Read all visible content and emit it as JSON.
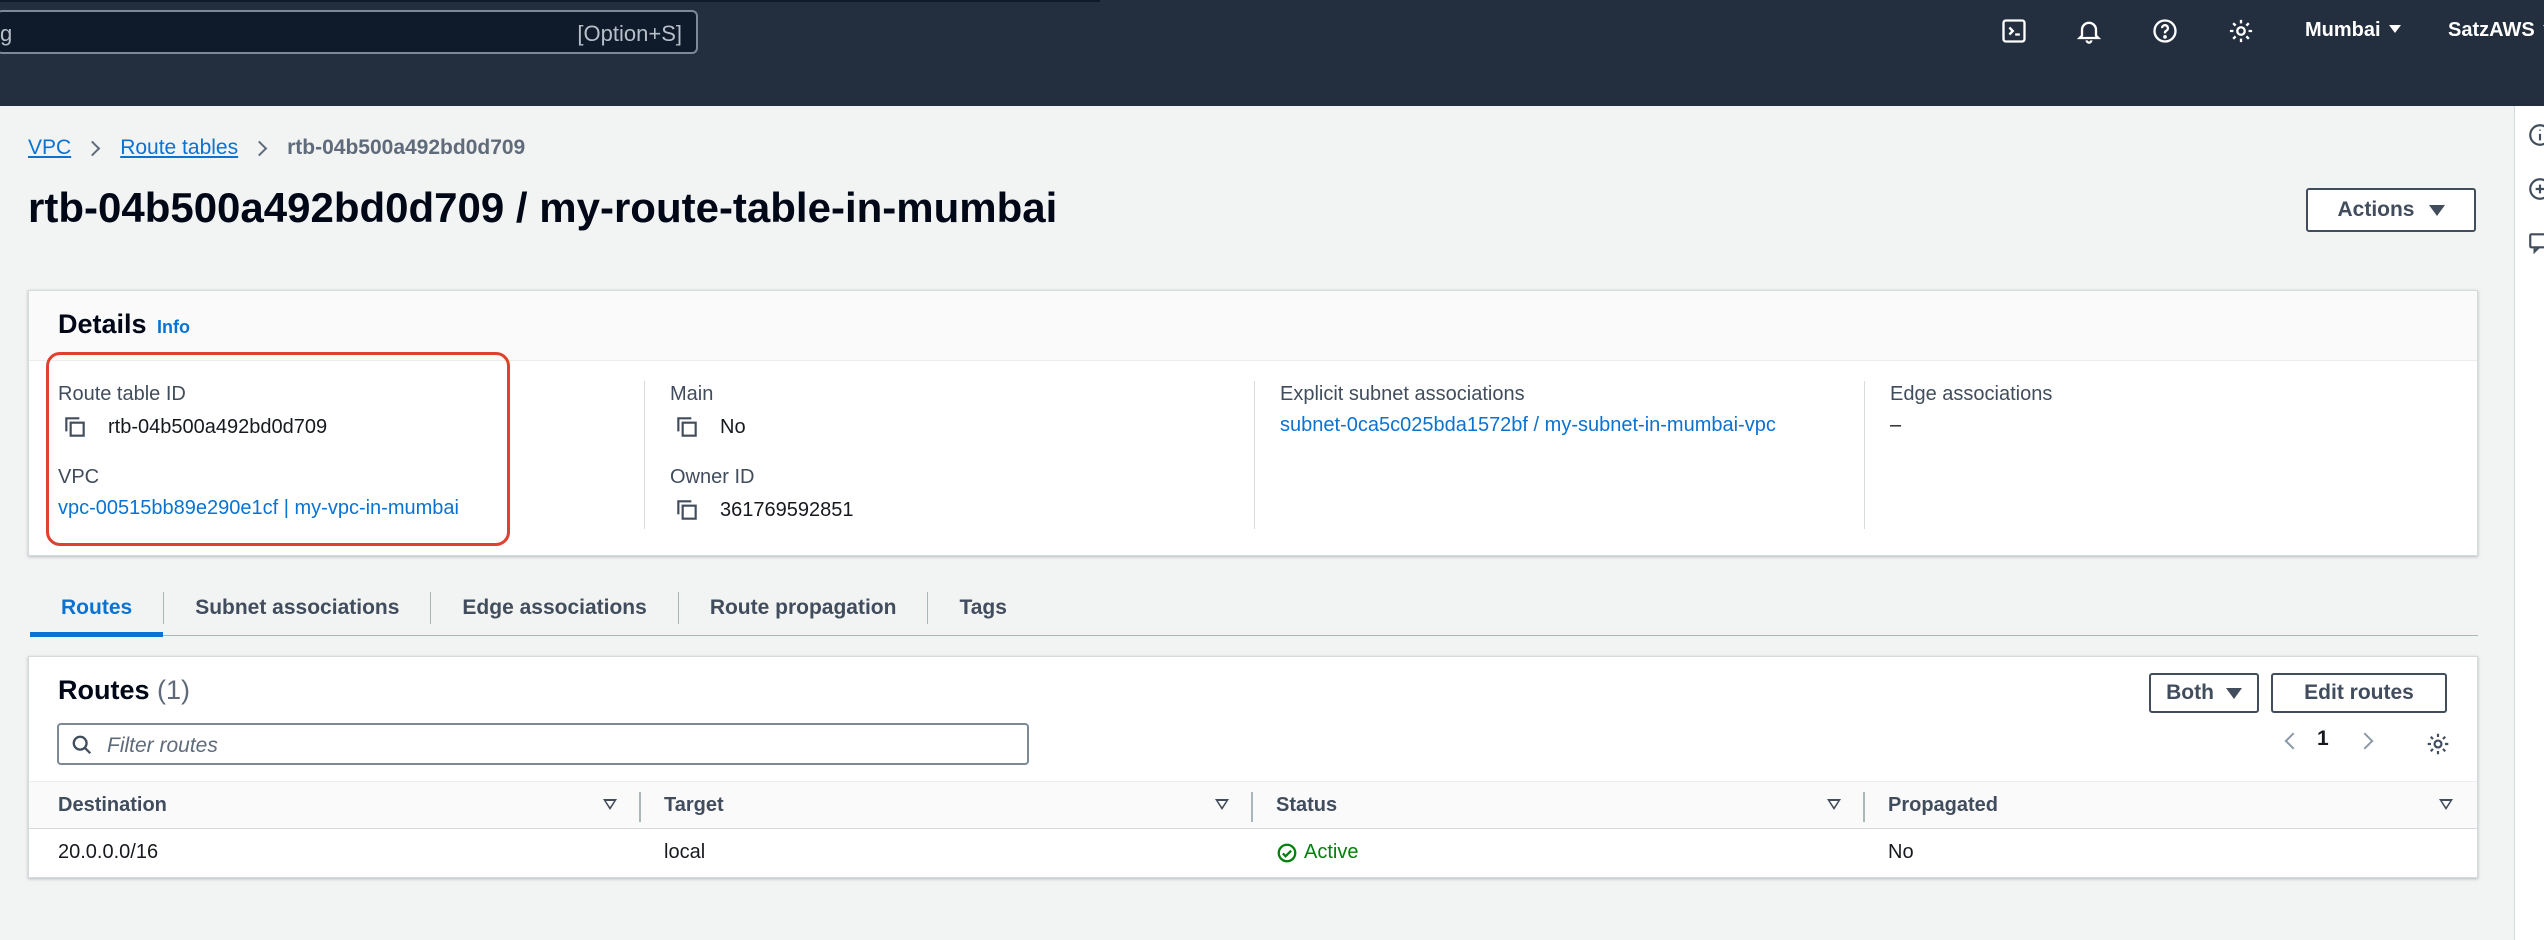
{
  "topbar": {
    "search_placeholder": "g",
    "search_shortcut": "[Option+S]",
    "region": "Mumbai",
    "account": "SatzAWS"
  },
  "breadcrumb": {
    "items": [
      "VPC",
      "Route tables"
    ],
    "current": "rtb-04b500a492bd0d709"
  },
  "page": {
    "title": "rtb-04b500a492bd0d709 / my-route-table-in-mumbai",
    "actions_label": "Actions"
  },
  "details": {
    "title": "Details",
    "info": "Info",
    "route_table_id_label": "Route table ID",
    "route_table_id": "rtb-04b500a492bd0d709",
    "vpc_label": "VPC",
    "vpc": "vpc-00515bb89e290e1cf | my-vpc-in-mumbai",
    "main_label": "Main",
    "main": "No",
    "owner_label": "Owner ID",
    "owner": "361769592851",
    "explicit_label": "Explicit subnet associations",
    "explicit": "subnet-0ca5c025bda1572bf / my-subnet-in-mumbai-vpc",
    "edge_label": "Edge associations",
    "edge": "–"
  },
  "tabs": [
    "Routes",
    "Subnet associations",
    "Edge associations",
    "Route propagation",
    "Tags"
  ],
  "routes": {
    "title": "Routes",
    "count": "(1)",
    "filter_placeholder": "Filter routes",
    "both_label": "Both",
    "edit_label": "Edit routes",
    "page_number": "1",
    "columns": [
      "Destination",
      "Target",
      "Status",
      "Propagated"
    ],
    "rows": [
      {
        "destination": "20.0.0.0/16",
        "target": "local",
        "status": "Active",
        "propagated": "No"
      }
    ]
  },
  "colors": {
    "nav_bg": "#232f3e",
    "link": "#0972d3",
    "active_green": "#037f0c",
    "highlight_red": "#e0412f"
  }
}
